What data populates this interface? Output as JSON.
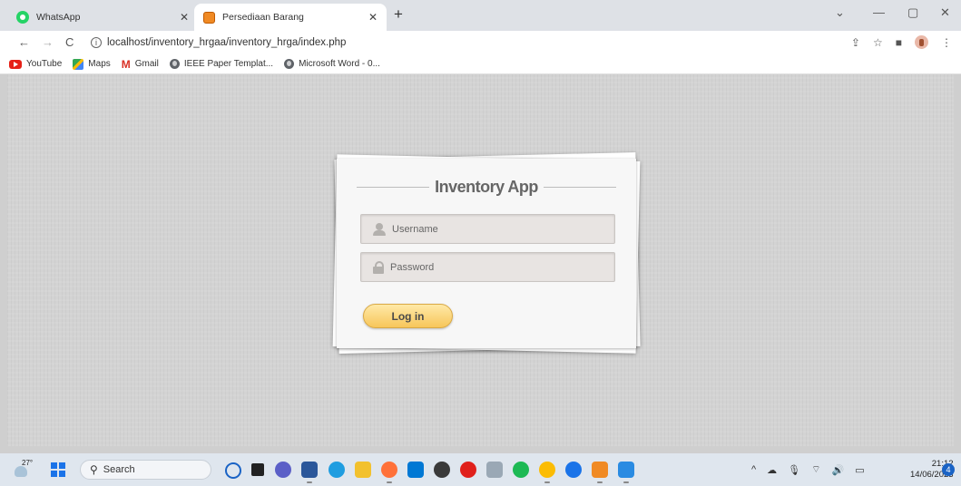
{
  "browser": {
    "tabs": [
      {
        "title": "WhatsApp",
        "active": false
      },
      {
        "title": "Persediaan Barang",
        "active": true
      }
    ],
    "new_tab": "+",
    "window_controls": [
      "⌄",
      "—",
      "▢",
      "✕"
    ],
    "url": "localhost/inventory_hrgaa/inventory_hrga/index.php",
    "bookmarks": [
      {
        "label": "YouTube",
        "icon": "youtube-icon"
      },
      {
        "label": "Maps",
        "icon": "maps-icon"
      },
      {
        "label": "Gmail",
        "icon": "gmail-icon"
      },
      {
        "label": "IEEE Paper Templat...",
        "icon": "globe-icon"
      },
      {
        "label": "Microsoft Word - 0...",
        "icon": "globe-icon"
      }
    ]
  },
  "login": {
    "title": "Inventory App",
    "username_placeholder": "Username",
    "password_placeholder": "Password",
    "button_label": "Log in"
  },
  "taskbar": {
    "weather_temp": "27°",
    "search_label": "Search",
    "clock_time": "21:12",
    "clock_date": "14/06/2023",
    "notification_count": "4"
  },
  "colors": {
    "page_background": "#d3d3d3",
    "button_gradient_top": "#ffe9a8",
    "button_gradient_bottom": "#f7c65a",
    "title_text": "#666666"
  }
}
